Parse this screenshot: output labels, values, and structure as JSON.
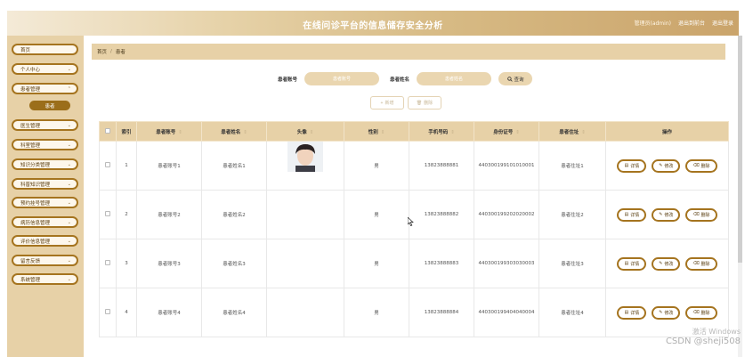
{
  "header": {
    "title": "在线问诊平台的信息储存安全分析",
    "user_link": "管理员(admin)",
    "front_link": "退出到前台",
    "logout_link": "退出登录"
  },
  "sidebar": {
    "items": [
      {
        "label": "首页",
        "chevron": false
      },
      {
        "label": "个人中心",
        "chevron": true
      },
      {
        "label": "患者管理",
        "chevron": true
      },
      {
        "label": "医生管理",
        "chevron": true
      },
      {
        "label": "科室管理",
        "chevron": true
      },
      {
        "label": "知识分类管理",
        "chevron": true
      },
      {
        "label": "科普知识管理",
        "chevron": true
      },
      {
        "label": "预约挂号管理",
        "chevron": true
      },
      {
        "label": "病历信息管理",
        "chevron": true
      },
      {
        "label": "评价信息管理",
        "chevron": true
      },
      {
        "label": "留言反馈",
        "chevron": true
      },
      {
        "label": "系统管理",
        "chevron": true
      }
    ],
    "active_sub": "患者"
  },
  "breadcrumb": {
    "home": "首页",
    "sep": "/",
    "current": "患者"
  },
  "search": {
    "account_label": "患者账号",
    "account_placeholder": "患者账号",
    "name_label": "患者姓名",
    "name_placeholder": "患者姓名",
    "button": "查询"
  },
  "actions": {
    "add": "新增",
    "delete": "删除"
  },
  "table": {
    "headers": [
      "索引",
      "患者账号",
      "患者姓名",
      "头像",
      "性别",
      "手机号码",
      "身份证号",
      "患者住址",
      "操作"
    ],
    "rows": [
      {
        "index": "1",
        "account": "患者账号1",
        "name": "患者姓名1",
        "gender": "男",
        "phone": "13823888881",
        "id_card": "440300199101010001",
        "address": "患者住址1"
      },
      {
        "index": "2",
        "account": "患者账号2",
        "name": "患者姓名2",
        "gender": "男",
        "phone": "13823888882",
        "id_card": "440300199202020002",
        "address": "患者住址2"
      },
      {
        "index": "3",
        "account": "患者账号3",
        "name": "患者姓名3",
        "gender": "男",
        "phone": "13823888883",
        "id_card": "440300199303030003",
        "address": "患者住址3"
      },
      {
        "index": "4",
        "account": "患者账号4",
        "name": "患者姓名4",
        "gender": "男",
        "phone": "13823888884",
        "id_card": "440300199404040004",
        "address": "患者住址4"
      }
    ],
    "op_labels": {
      "detail": "详情",
      "edit": "修改",
      "delete": "删除"
    }
  },
  "watermark": {
    "line1": "激活 Windows",
    "line2": "CSDN @sheji508"
  },
  "colors": {
    "accent": "#a5741f",
    "panel": "#e7d1a7"
  }
}
